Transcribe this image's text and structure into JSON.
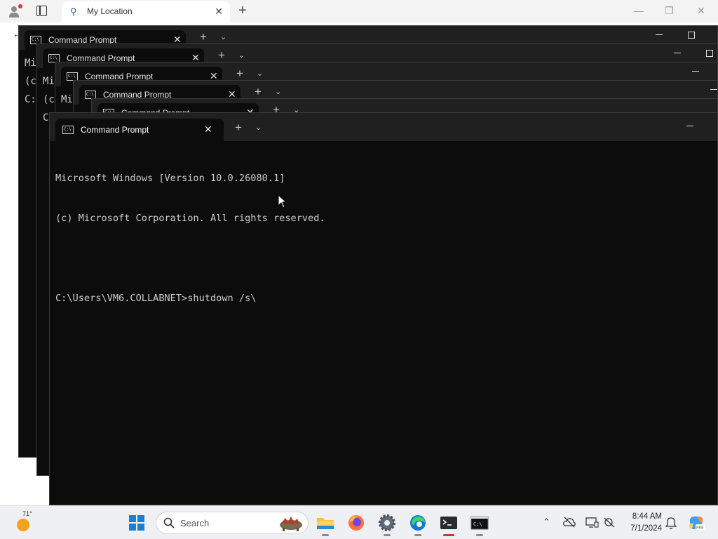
{
  "browser": {
    "tab_title": "My Location",
    "tab_favicon": "location-pin-icon",
    "controls": [
      "minimize-icon",
      "restore-icon",
      "close-icon"
    ]
  },
  "stacked_windows": [
    {
      "tab_title": "Command Prompt",
      "lines": [
        "Mi",
        "(c",
        "",
        "C:"
      ]
    },
    {
      "tab_title": "Command Prompt",
      "lines": [
        "Mi",
        "(c",
        "",
        "C:"
      ]
    },
    {
      "tab_title": "Command Prompt",
      "lines": [
        "Mi",
        "(c"
      ]
    },
    {
      "tab_title": "Command Prompt",
      "lines": []
    },
    {
      "tab_title": "Command Prompt",
      "lines": []
    }
  ],
  "terminal": {
    "tab_title": "Command Prompt",
    "line1": "Microsoft Windows [Version 10.0.26080.1]",
    "line2": "(c) Microsoft Corporation. All rights reserved.",
    "line3": "",
    "prompt": "C:\\Users\\VM6.COLLABNET>",
    "command": "shutdown /s\\"
  },
  "taskbar": {
    "weather_temp": "71°",
    "search_label": "Search",
    "apps": [
      "file-explorer-icon",
      "firefox-icon",
      "settings-icon",
      "edge-icon",
      "terminal-icon",
      "command-prompt-icon"
    ],
    "tray": [
      "chevron-up-icon",
      "cloud-offline-icon",
      "display-icon",
      "network-icon",
      "notification-bell-icon",
      "copilot-icon"
    ],
    "time": "8:44 AM",
    "date": "7/1/2024",
    "colors": {
      "accent": "#1a7fd6",
      "active_indicator": "#d13438"
    }
  }
}
